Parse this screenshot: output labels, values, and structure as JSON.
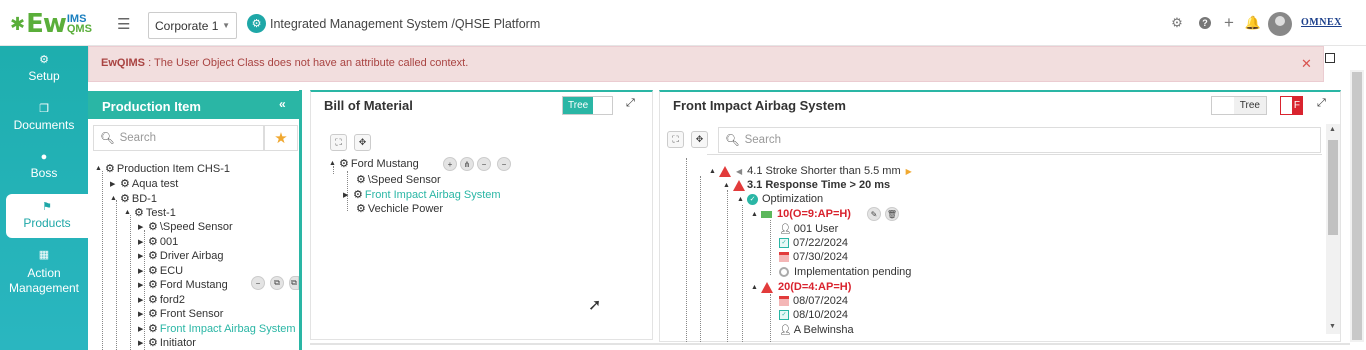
{
  "app": {
    "logo_ew": "Ew",
    "logo_ims": "IMS",
    "logo_qms": "QMS",
    "company_select": "Corporate 1",
    "system_title": "Integrated Management System /QHSE Platform",
    "brand": "OMNEX"
  },
  "topbar_icons": [
    "gear-icon",
    "help-icon",
    "plus-icon",
    "bell-icon"
  ],
  "sidebar": {
    "items": [
      {
        "label": "Setup",
        "icon": "gears-icon"
      },
      {
        "label": "Documents",
        "icon": "documents-icon"
      },
      {
        "label": "Boss",
        "icon": "user-icon"
      },
      {
        "label": "Products",
        "icon": "products-icon",
        "active": true
      },
      {
        "label": "Action Management",
        "icon": "building-icon"
      }
    ]
  },
  "error": {
    "prefix": "EwQIMS",
    "message": " : The User Object Class does not have an attribute called context."
  },
  "production": {
    "title": "Production Item",
    "search_placeholder": "Search",
    "nodes": [
      "Production Item CHS-1",
      "Aqua test",
      "BD-1",
      "Test-1",
      "\\Speed Sensor",
      "001",
      "Driver Airbag",
      "ECU",
      "Ford Mustang",
      "ford2",
      "Front Sensor",
      "Front Impact Airbag System",
      "Initiator"
    ]
  },
  "bom": {
    "title": "Bill of Material",
    "toggle": "Tree",
    "nodes": [
      "Ford Mustang",
      "\\Speed Sensor",
      "Front Impact Airbag System",
      "Vechicle Power"
    ]
  },
  "airbag": {
    "title": "Front Impact Airbag System",
    "toggle": "Tree",
    "toggle_right": "F",
    "search_placeholder": "Search",
    "nodes": {
      "stroke": "4.1 Stroke Shorter than 5.5 mm",
      "response": "3.1 Response Time > 20 ms",
      "optimization": "Optimization",
      "action1": "10(O=9:AP=H)",
      "user1": "001 User",
      "date1": "07/22/2024",
      "date2": "07/30/2024",
      "status": "Implementation pending",
      "action2": "20(D=4:AP=H)",
      "date3": "08/07/2024",
      "date4": "08/10/2024",
      "user2": "A Belwinsha"
    }
  }
}
